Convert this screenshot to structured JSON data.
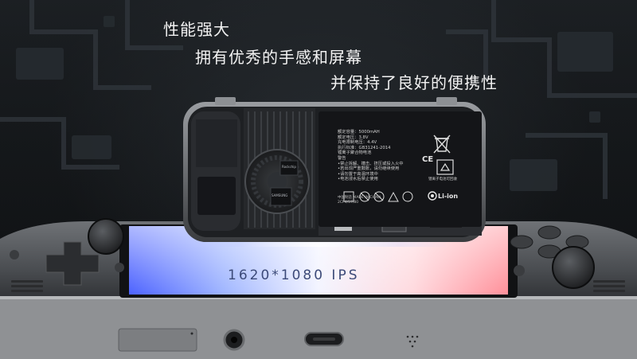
{
  "headline": {
    "line1": "性能强大",
    "line2": "拥有优秀的手感和屏幕",
    "line3": "并保持了良好的便携性"
  },
  "screen": {
    "label": "1620*1080 IPS"
  },
  "battery_label": {
    "lines": [
      "额定容量：5000mAH",
      "额定电压：3.8V",
      "充电限制电压：4.4V",
      "执行标准：GB31241-2014",
      "锂离子聚合物电池",
      "警告",
      "•禁止拆解、撞击、挤压或投入火中",
      "•若出现严重鼓胀，请勿继续使用",
      "•请勿置于高温环境中",
      "•电池浸水后禁止使用"
    ],
    "footer": "中国制造 MADE IN CHINA",
    "footer2": "2CP4/57/80",
    "chemistry": "Li-ion",
    "recycle_note": "锂离子电池可回收",
    "ce_mark": "CE"
  },
  "chip_marks": {
    "samsung": "SAMSUNG",
    "soc": "Rockchip"
  },
  "colors": {
    "background": "#0e1012",
    "headline": "#f2f2f2",
    "console_body": "#9a9c9f",
    "screen_glow_left": "#5b6fff",
    "screen_glow_right": "#ff9fa8"
  }
}
